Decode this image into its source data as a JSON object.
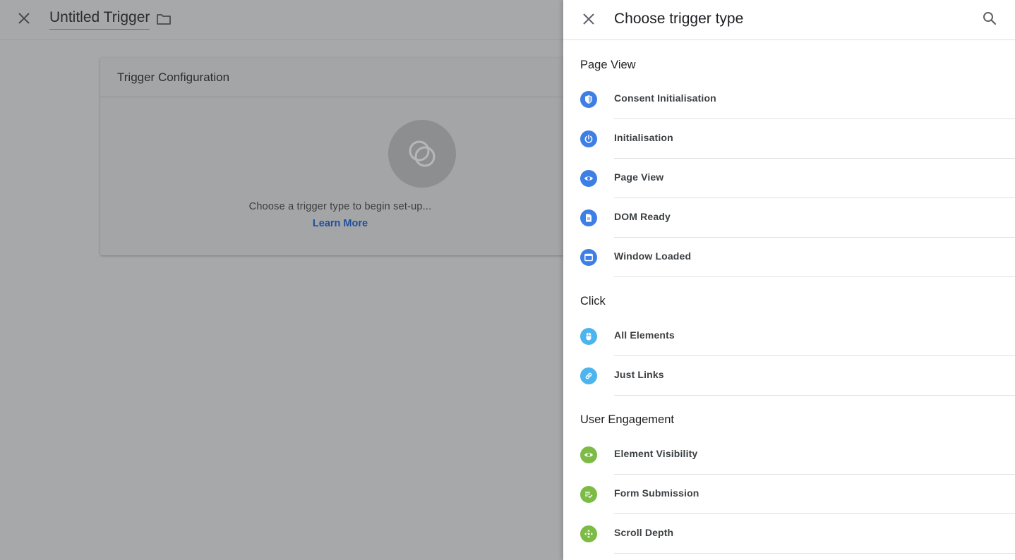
{
  "editor": {
    "title": "Untitled Trigger",
    "card_title": "Trigger Configuration",
    "card_hint": "Choose a trigger type to begin set-up...",
    "card_link": "Learn More"
  },
  "panel": {
    "title": "Choose trigger type",
    "sections": [
      {
        "title": "Page View",
        "items": [
          {
            "label": "Consent Initialisation",
            "icon": "shield-icon",
            "color": "#3e7fe6"
          },
          {
            "label": "Initialisation",
            "icon": "power-icon",
            "color": "#3e7fe6"
          },
          {
            "label": "Page View",
            "icon": "eye-icon",
            "color": "#3e7fe6"
          },
          {
            "label": "DOM Ready",
            "icon": "document-icon",
            "color": "#3e7fe6"
          },
          {
            "label": "Window Loaded",
            "icon": "window-icon",
            "color": "#3e7fe6"
          }
        ]
      },
      {
        "title": "Click",
        "items": [
          {
            "label": "All Elements",
            "icon": "mouse-icon",
            "color": "#4cb4ee"
          },
          {
            "label": "Just Links",
            "icon": "link-icon",
            "color": "#4cb4ee"
          }
        ]
      },
      {
        "title": "User Engagement",
        "items": [
          {
            "label": "Element Visibility",
            "icon": "eye-icon",
            "color": "#7cbb45"
          },
          {
            "label": "Form Submission",
            "icon": "form-check-icon",
            "color": "#7cbb45"
          },
          {
            "label": "Scroll Depth",
            "icon": "scroll-move-icon",
            "color": "#7cbb45"
          }
        ]
      }
    ]
  }
}
